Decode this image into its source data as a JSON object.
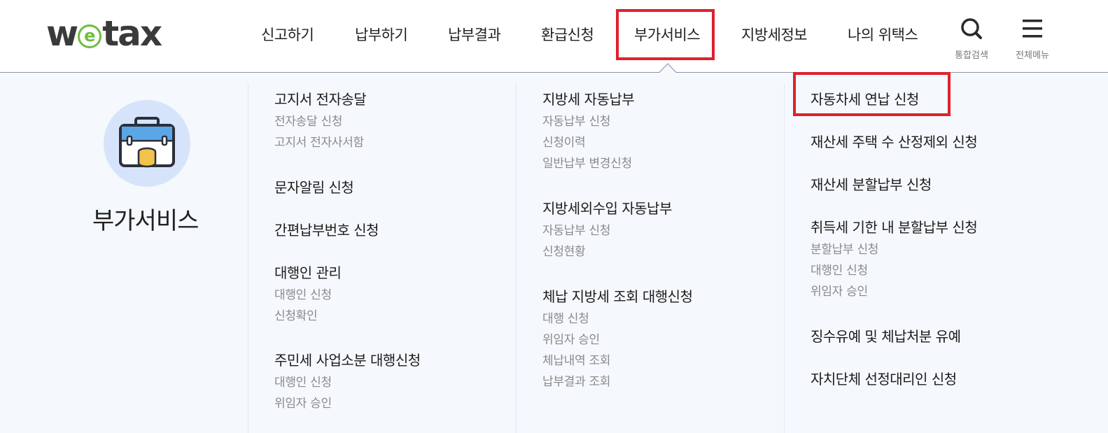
{
  "logo": {
    "pre": "w",
    "mid": "e",
    "post": "tax"
  },
  "nav": {
    "items": [
      "신고하기",
      "납부하기",
      "납부결과",
      "환급신청",
      "부가서비스",
      "지방세정보",
      "나의 위택스"
    ],
    "active": "부가서비스"
  },
  "tools": {
    "search_label": "통합검색",
    "menu_label": "전체메뉴"
  },
  "section": {
    "title": "부가서비스"
  },
  "columns": [
    {
      "groups": [
        {
          "title": "고지서 전자송달",
          "subs": [
            "전자송달 신청",
            "고지서 전자사서함"
          ]
        },
        {
          "title": "문자알림 신청",
          "subs": []
        },
        {
          "title": "간편납부번호 신청",
          "subs": []
        },
        {
          "title": "대행인 관리",
          "subs": [
            "대행인 신청",
            "신청확인"
          ]
        },
        {
          "title": "주민세 사업소분 대행신청",
          "subs": [
            "대행인 신청",
            "위임자 승인"
          ]
        }
      ]
    },
    {
      "groups": [
        {
          "title": "지방세 자동납부",
          "subs": [
            "자동납부 신청",
            "신청이력",
            "일반납부 변경신청"
          ]
        },
        {
          "title": "지방세외수입 자동납부",
          "subs": [
            "자동납부 신청",
            "신청현황"
          ]
        },
        {
          "title": "체납 지방세 조회 대행신청",
          "subs": [
            "대행 신청",
            "위임자 승인",
            "체납내역 조회",
            "납부결과 조회"
          ]
        }
      ]
    },
    {
      "groups": [
        {
          "title": "자동차세 연납 신청",
          "subs": []
        },
        {
          "title": "재산세 주택 수 산정제외 신청",
          "subs": []
        },
        {
          "title": "재산세 분할납부 신청",
          "subs": []
        },
        {
          "title": "취득세 기한 내 분할납부 신청",
          "subs": [
            "분할납부 신청",
            "대행인 신청",
            "위임자 승인"
          ]
        },
        {
          "title": "징수유예 및 체납처분 유예",
          "subs": []
        },
        {
          "title": "자치단체 선정대리인 신청",
          "subs": []
        }
      ]
    }
  ],
  "colors": {
    "accent_box": "#e0202c",
    "logo_e": "#6cbf3a",
    "panel_bg": "#f5f8fc",
    "badge_bg": "#d6e4fb"
  }
}
